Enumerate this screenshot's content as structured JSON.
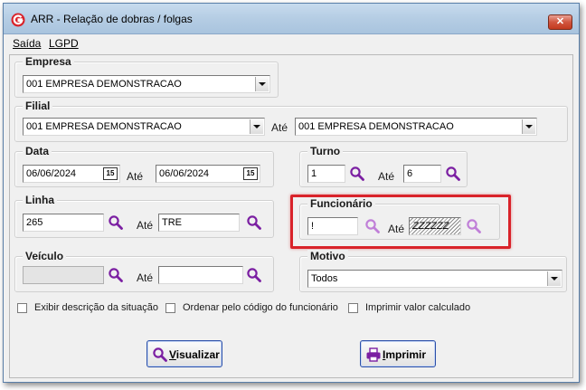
{
  "window": {
    "title": "ARR - Relação de dobras / folgas",
    "close_label": "✕"
  },
  "menu": [
    "Saída",
    "LGPD"
  ],
  "empresa": {
    "legend": "Empresa",
    "value": "001 EMPRESA DEMONSTRACAO"
  },
  "filial": {
    "legend": "Filial",
    "from": "001 EMPRESA DEMONSTRACAO",
    "ate_label": "Até",
    "to": "001 EMPRESA DEMONSTRACAO"
  },
  "data": {
    "legend": "Data",
    "from": "06/06/2024",
    "ate_label": "Até",
    "to": "06/06/2024",
    "calendar_glyph": "15"
  },
  "turno": {
    "legend": "Turno",
    "from": "1",
    "ate_label": "Até",
    "to": "6"
  },
  "linha": {
    "legend": "Linha",
    "from": "265",
    "ate_label": "Até",
    "to": "TRE"
  },
  "funcionario": {
    "legend": "Funcionário",
    "from": "!",
    "ate_label": "Até",
    "to": "ZZZZZZ"
  },
  "veiculo": {
    "legend": "Veículo",
    "from": "",
    "ate_label": "Até",
    "to": ""
  },
  "motivo": {
    "legend": "Motivo",
    "value": "Todos"
  },
  "options": [
    {
      "label": "Exibir descrição da situação",
      "checked": false
    },
    {
      "label": "Ordenar pelo código do funcionário",
      "checked": false
    },
    {
      "label": "Imprimir valor calculado",
      "checked": false
    }
  ],
  "buttons": {
    "visualizar": "Visualizar",
    "imprimir": "Imprimir"
  },
  "colors": {
    "search_icon": "#7b1fa2",
    "highlight_border": "#d9232a",
    "button_border": "#2b4fa8"
  }
}
